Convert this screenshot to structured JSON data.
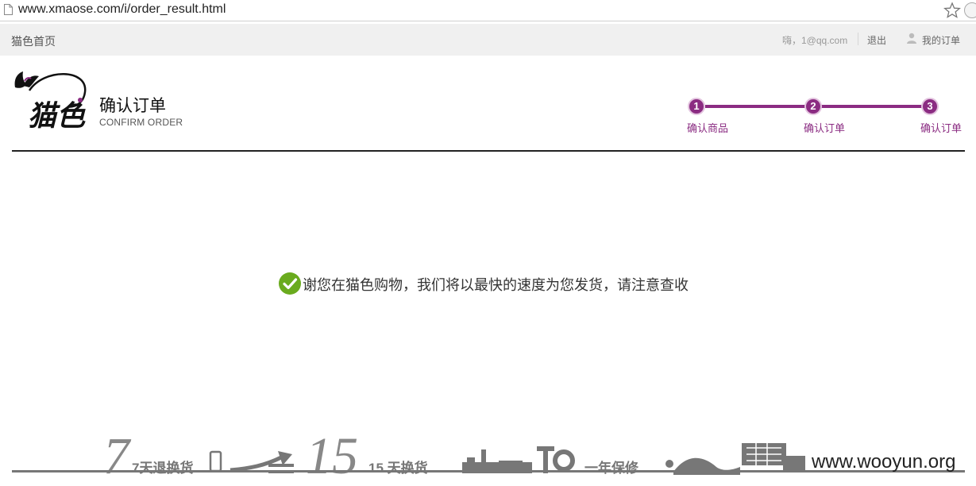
{
  "browser": {
    "url": "www.xmaose.com/i/order_result.html"
  },
  "topbar": {
    "home_link": "猫色首页",
    "greeting": "嗨，1@qq.com",
    "logout": "退出",
    "my_orders": "我的订单"
  },
  "header": {
    "logo_text": "猫色",
    "title": "确认订单",
    "subtitle": "CONFIRM ORDER"
  },
  "steps": [
    {
      "number": "1",
      "label": "确认商品"
    },
    {
      "number": "2",
      "label": "确认订单"
    },
    {
      "number": "3",
      "label": "确认订单"
    }
  ],
  "message": {
    "text": "谢您在猫色购物，我们将以最快的速度为您发货，请注意查收"
  },
  "footer": {
    "service1_number": "7",
    "service1_text": "7天退换货",
    "service2_number": "15",
    "service2_text": "15 天换货",
    "service3_text": "一年保修",
    "watermark": "www.wooyun.org"
  },
  "colors": {
    "accent": "#8b2c82",
    "success": "#6aab1e"
  }
}
